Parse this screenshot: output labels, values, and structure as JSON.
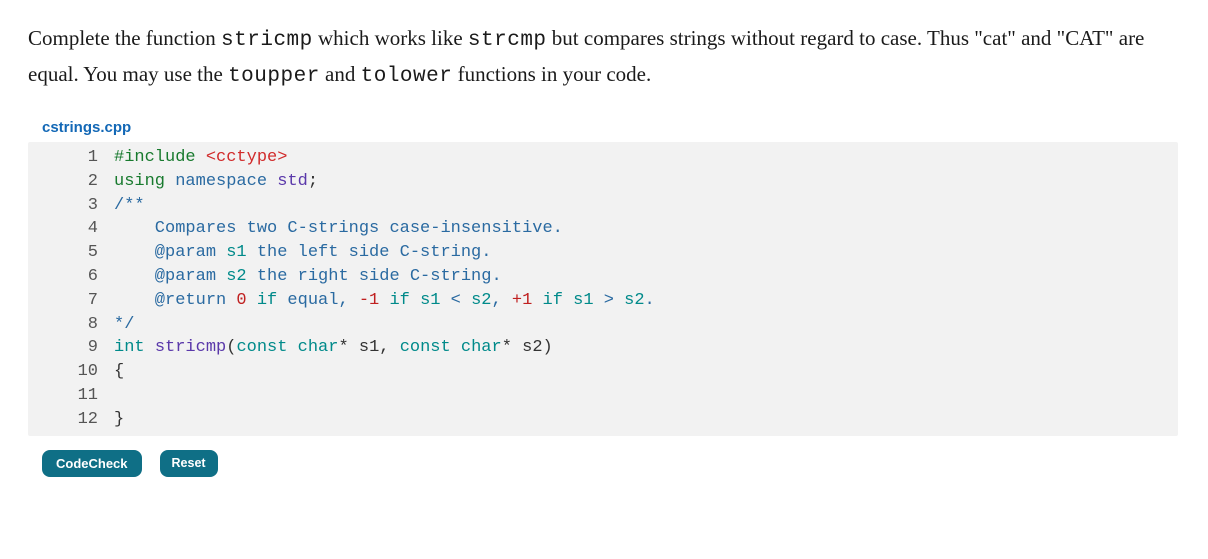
{
  "problem": {
    "pre1": "Complete the function ",
    "code1": "stricmp",
    "mid1": " which works like ",
    "code2": "strcmp",
    "mid2": " but compares strings without regard to case. Thus \"cat\" and \"CAT\" are equal. You may use the ",
    "code3": "toupper",
    "mid3": " and ",
    "code4": "tolower",
    "mid4": " functions in your code."
  },
  "filename": "cstrings.cpp",
  "code": {
    "linenos": [
      "1",
      "2",
      "3",
      "4",
      "5",
      "6",
      "7",
      "8",
      "9",
      "10",
      "11",
      "12"
    ],
    "l1": {
      "a": "#include ",
      "b": "<cctype>"
    },
    "l2": {
      "a": "using",
      "b": " ",
      "c": "namespace",
      "d": " ",
      "e": "std",
      "f": ";"
    },
    "l3": {
      "a": "/**"
    },
    "l4": {
      "a": "    Compares two C-strings case-insensitive."
    },
    "l5": {
      "a": "    @param ",
      "b": "s1",
      "c": " the left side C-string."
    },
    "l6": {
      "a": "    @param ",
      "b": "s2",
      "c": " the right side C-string."
    },
    "l7": {
      "a": "    @return ",
      "b": "0",
      "c": " ",
      "d": "if",
      "e": " equal, ",
      "f": "-1",
      "g": " ",
      "h": "if",
      "i": " ",
      "j": "s1",
      "k": " < ",
      "l": "s2",
      "m": ", ",
      "n": "+1",
      "o": " ",
      "p": "if",
      "q": " ",
      "r": "s1",
      "s": " > ",
      "t": "s2",
      "u": "."
    },
    "l8": {
      "a": "*/"
    },
    "l9": {
      "a": "int",
      "b": " ",
      "c": "stricmp",
      "d": "(",
      "e": "const",
      "f": " ",
      "g": "char",
      "h": "* ",
      "i": "s1",
      "j": ", ",
      "k": "const",
      "l": " ",
      "m": "char",
      "n": "* ",
      "o": "s2",
      "p": ")"
    },
    "l10": {
      "a": "{"
    },
    "l11": {
      "a": ""
    },
    "l12": {
      "a": "}"
    }
  },
  "buttons": {
    "codecheck": "CodeCheck",
    "reset": "Reset"
  }
}
